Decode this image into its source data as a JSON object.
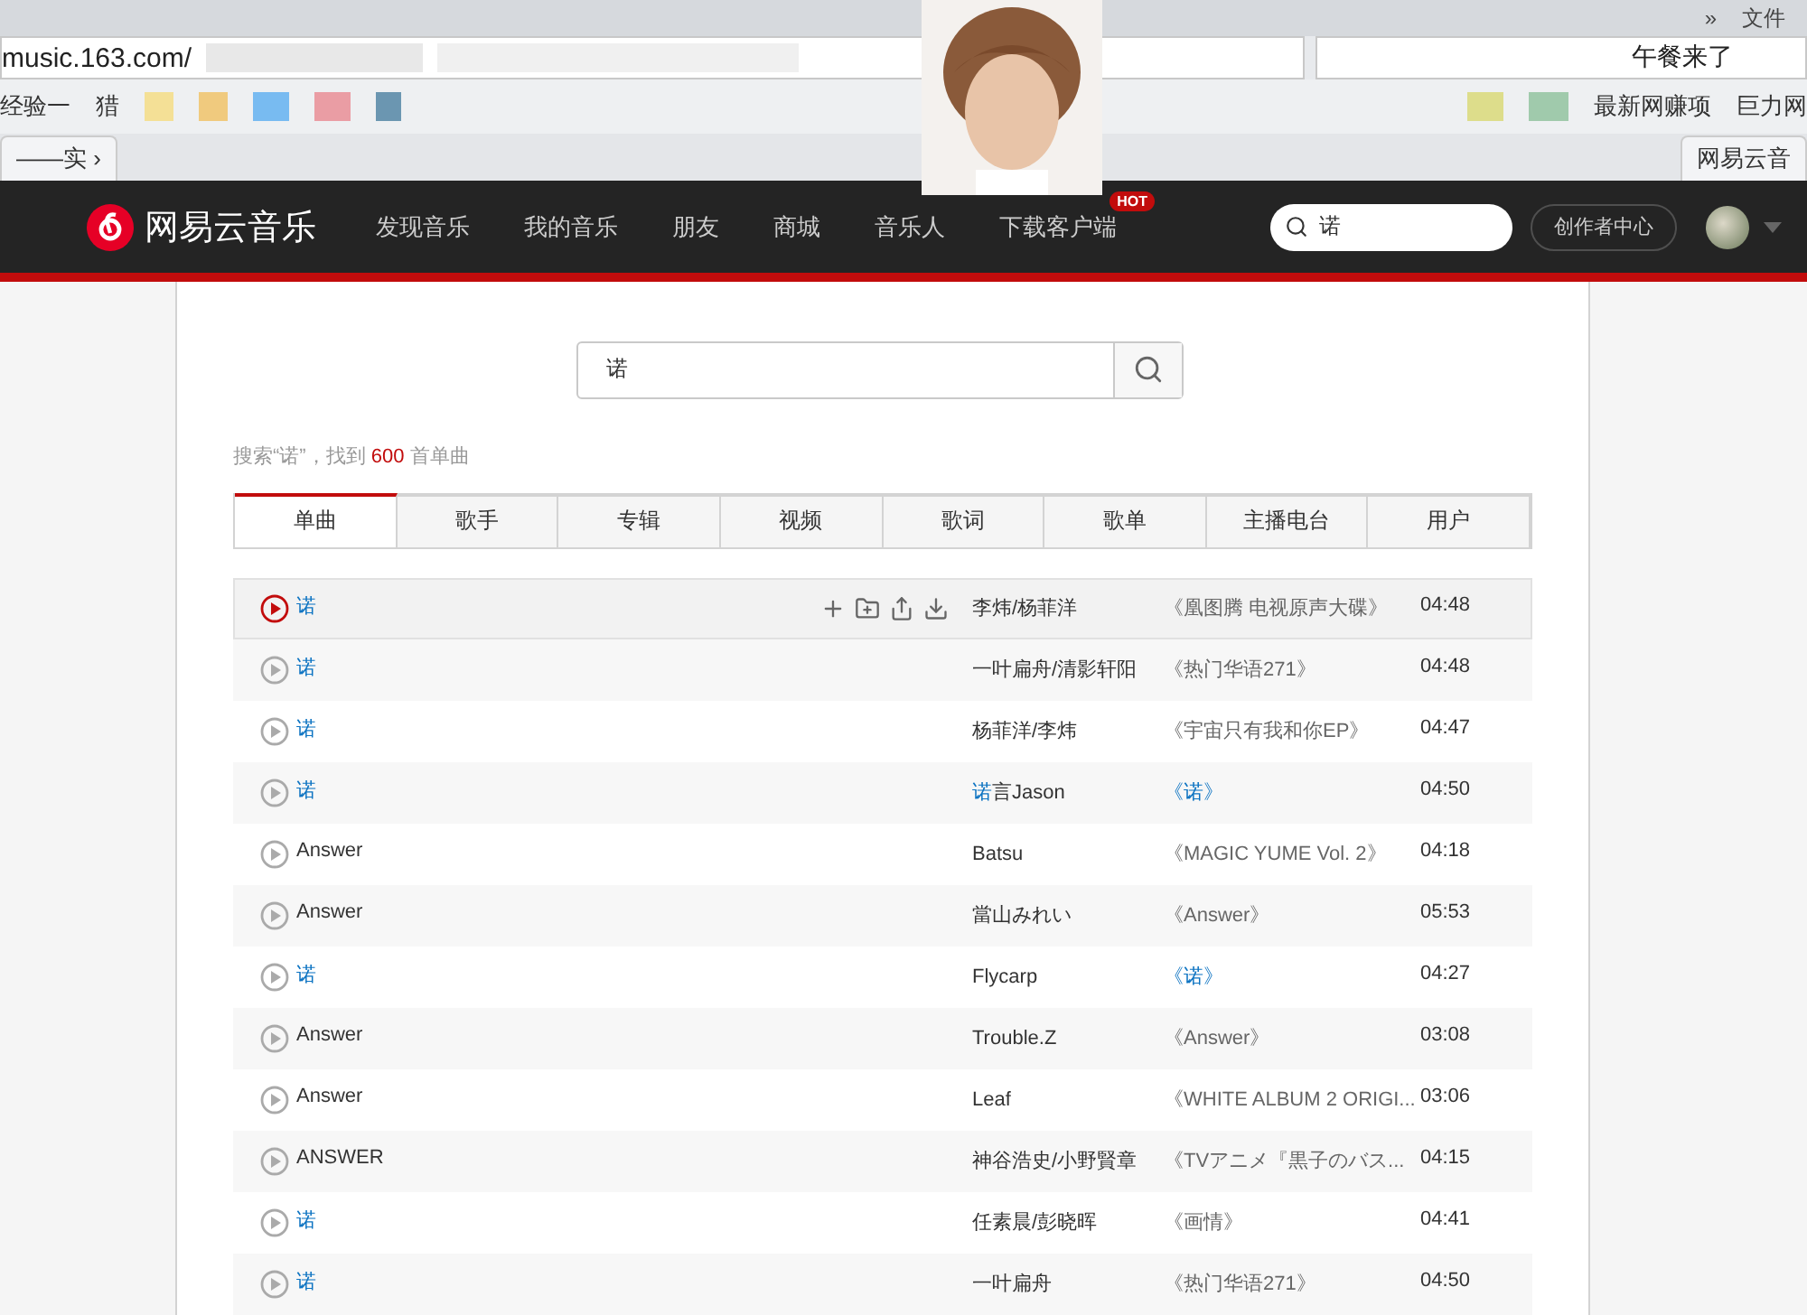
{
  "browser": {
    "overflow_glyph": "»",
    "menu_label": "文件",
    "address": "music.163.com/",
    "address_right": "午餐来了",
    "bookmarks": [
      "经验一",
      "猎",
      "最新网赚项",
      "巨力网"
    ],
    "tab_left": "——实",
    "tab_arrow": "›",
    "tab_right": "网易云音"
  },
  "nav": {
    "logo": "网易云音乐",
    "items": [
      {
        "label": "发现音乐"
      },
      {
        "label": "我的音乐"
      },
      {
        "label": "朋友"
      },
      {
        "label": "商城"
      },
      {
        "label": "音乐人"
      },
      {
        "label": "下载客户端",
        "badge": "HOT"
      }
    ],
    "search": "诺",
    "creator": "创作者中心"
  },
  "search": {
    "value": "诺"
  },
  "summary": {
    "before": "搜索“诺”，找到 ",
    "count": "600",
    "after": " 首单曲"
  },
  "tabs": [
    {
      "label": "单曲",
      "selected": true
    },
    {
      "label": "歌手",
      "selected": false
    },
    {
      "label": "专辑",
      "selected": false
    },
    {
      "label": "视频",
      "selected": false
    },
    {
      "label": "歌词",
      "selected": false
    },
    {
      "label": "歌单",
      "selected": false
    },
    {
      "label": "主播电台",
      "selected": false
    },
    {
      "label": "用户",
      "selected": false
    }
  ],
  "songs": [
    {
      "title": "诺",
      "title_match": true,
      "artist": "李炜/杨菲洋",
      "album": "《凰图腾 电视原声大碟》",
      "album_match": false,
      "duration": "04:48",
      "selected": true
    },
    {
      "title": "诺",
      "title_match": true,
      "artist": "一叶扁舟/清影轩阳",
      "album": "《热门华语271》",
      "album_match": false,
      "duration": "04:48",
      "selected": false
    },
    {
      "title": "诺",
      "title_match": true,
      "artist": "杨菲洋/李炜",
      "album": "《宇宙只有我和你EP》",
      "album_match": false,
      "duration": "04:47",
      "selected": false
    },
    {
      "title": "诺",
      "title_match": true,
      "artist_prefix": "诺",
      "artist": "言Jason",
      "album": "《诺》",
      "album_match": true,
      "duration": "04:50",
      "selected": false
    },
    {
      "title": "Answer",
      "title_match": false,
      "artist": "Batsu",
      "album": "《MAGIC YUME Vol. 2》",
      "album_match": false,
      "duration": "04:18",
      "selected": false
    },
    {
      "title": "Answer",
      "title_match": false,
      "artist": "當山みれい",
      "album": "《Answer》",
      "album_match": false,
      "duration": "05:53",
      "selected": false
    },
    {
      "title": "诺",
      "title_match": true,
      "artist": "Flycarp",
      "album": "《诺》",
      "album_match": true,
      "duration": "04:27",
      "selected": false
    },
    {
      "title": "Answer",
      "title_match": false,
      "artist": "Trouble.Z",
      "album": "《Answer》",
      "album_match": false,
      "duration": "03:08",
      "selected": false
    },
    {
      "title": "Answer",
      "title_match": false,
      "artist": "Leaf",
      "album": "《WHITE ALBUM 2 ORIGI...",
      "album_match": false,
      "duration": "03:06",
      "selected": false
    },
    {
      "title": "ANSWER",
      "title_match": false,
      "artist": "神谷浩史/小野賢章",
      "album": "《TVアニメ『黒子のバス...",
      "album_match": false,
      "duration": "04:15",
      "selected": false
    },
    {
      "title": "诺",
      "title_match": true,
      "artist": "任素晨/彭晓晖",
      "album": "《画情》",
      "album_match": false,
      "duration": "04:41",
      "selected": false
    },
    {
      "title": "诺",
      "title_match": true,
      "artist": "一叶扁舟",
      "album": "《热门华语271》",
      "album_match": false,
      "duration": "04:50",
      "selected": false
    }
  ]
}
